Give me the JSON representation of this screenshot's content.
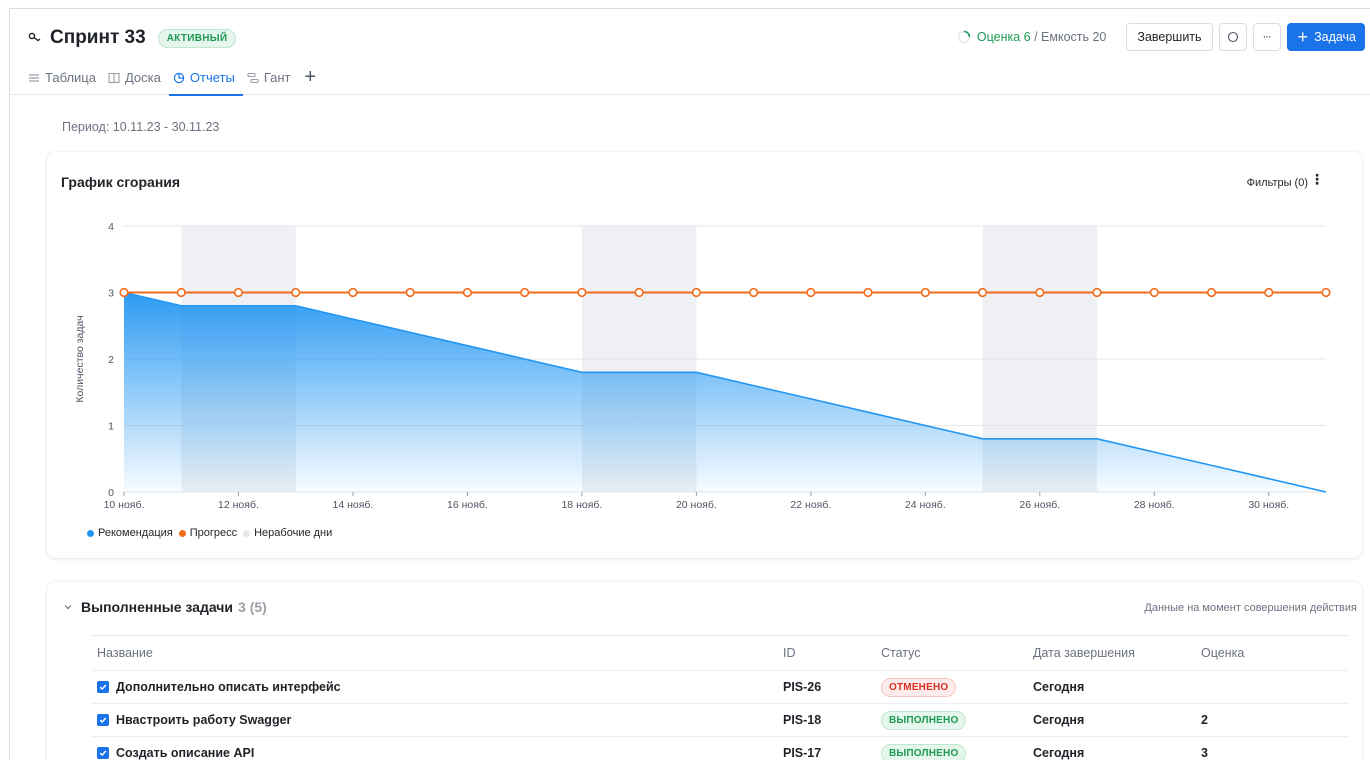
{
  "header": {
    "title": "Спринт 33",
    "status_badge": "АКТИВНЫЙ",
    "estimate_label": "Оценка 6",
    "capacity_label": "/ Емкость 20",
    "finish_button": "Завершить",
    "more_button": "···",
    "add_task_button": "Задача"
  },
  "tabs": [
    {
      "label": "Таблица",
      "icon": "list-icon"
    },
    {
      "label": "Доска",
      "icon": "board-icon"
    },
    {
      "label": "Отчеты",
      "icon": "reports-icon",
      "active": true
    },
    {
      "label": "Гант",
      "icon": "gantt-icon"
    }
  ],
  "period": "Период: 10.11.23 - 30.11.23",
  "chart_card": {
    "title": "График сгорания",
    "filters": "Фильтры (0)",
    "more": "⋮"
  },
  "chart_data": {
    "type": "area",
    "title": "График сгорания",
    "ylabel": "Количество задач",
    "xlabel": "",
    "ylim": [
      0,
      4
    ],
    "y_ticks": [
      "0",
      "1",
      "2",
      "3",
      "4"
    ],
    "x_ticks": [
      "10 нояб.",
      "12 нояб.",
      "14 нояб.",
      "16 нояб.",
      "18 нояб.",
      "20 нояб.",
      "22 нояб.",
      "24 нояб.",
      "26 нояб.",
      "28 нояб.",
      "30 нояб."
    ],
    "x_days": [
      10,
      11,
      12,
      13,
      14,
      15,
      16,
      17,
      18,
      19,
      20,
      21,
      22,
      23,
      24,
      25,
      26,
      27,
      28,
      29,
      30,
      31
    ],
    "grid": true,
    "legend_position": "bottom-left",
    "series": [
      {
        "name": "Рекомендация",
        "color": "#2196f3",
        "kind": "area",
        "values": [
          3,
          2.8,
          2.8,
          2.8,
          2.6,
          2.4,
          2.2,
          2.0,
          1.8,
          1.8,
          1.8,
          1.6,
          1.4,
          1.2,
          1.0,
          0.8,
          0.8,
          0.8,
          0.6,
          0.4,
          0.2,
          0
        ]
      },
      {
        "name": "Прогресс",
        "color": "#f26b1d",
        "kind": "line-markers",
        "values": [
          3,
          3,
          3,
          3,
          3,
          3,
          3,
          3,
          3,
          3,
          3,
          3,
          3,
          3,
          3,
          3,
          3,
          3,
          3,
          3,
          3,
          3
        ]
      },
      {
        "name": "Нерабочие дни",
        "color": "#eef0f3",
        "kind": "bands",
        "ranges": [
          [
            11,
            13
          ],
          [
            18,
            20
          ],
          [
            25,
            27
          ]
        ]
      }
    ]
  },
  "tasks": {
    "title": "Выполненные задачи",
    "count": "3",
    "total": "(5)",
    "note": "Данные на момент совершения действия",
    "columns": {
      "name": "Название",
      "id": "ID",
      "status": "Статус",
      "date": "Дата завершения",
      "estimate": "Оценка"
    },
    "rows": [
      {
        "name": "Дополнительно описать интерфейс",
        "id": "PIS-26",
        "status": "ОТМЕНЕНО",
        "status_kind": "red",
        "date": "Сегодня",
        "estimate": ""
      },
      {
        "name": "Нвастроить работу Swagger",
        "id": "PIS-18",
        "status": "ВЫПОЛНЕНО",
        "status_kind": "green",
        "date": "Сегодня",
        "estimate": "2"
      },
      {
        "name": "Создать описание API",
        "id": "PIS-17",
        "status": "ВЫПОЛНЕНО",
        "status_kind": "green",
        "date": "Сегодня",
        "estimate": "3"
      }
    ]
  }
}
